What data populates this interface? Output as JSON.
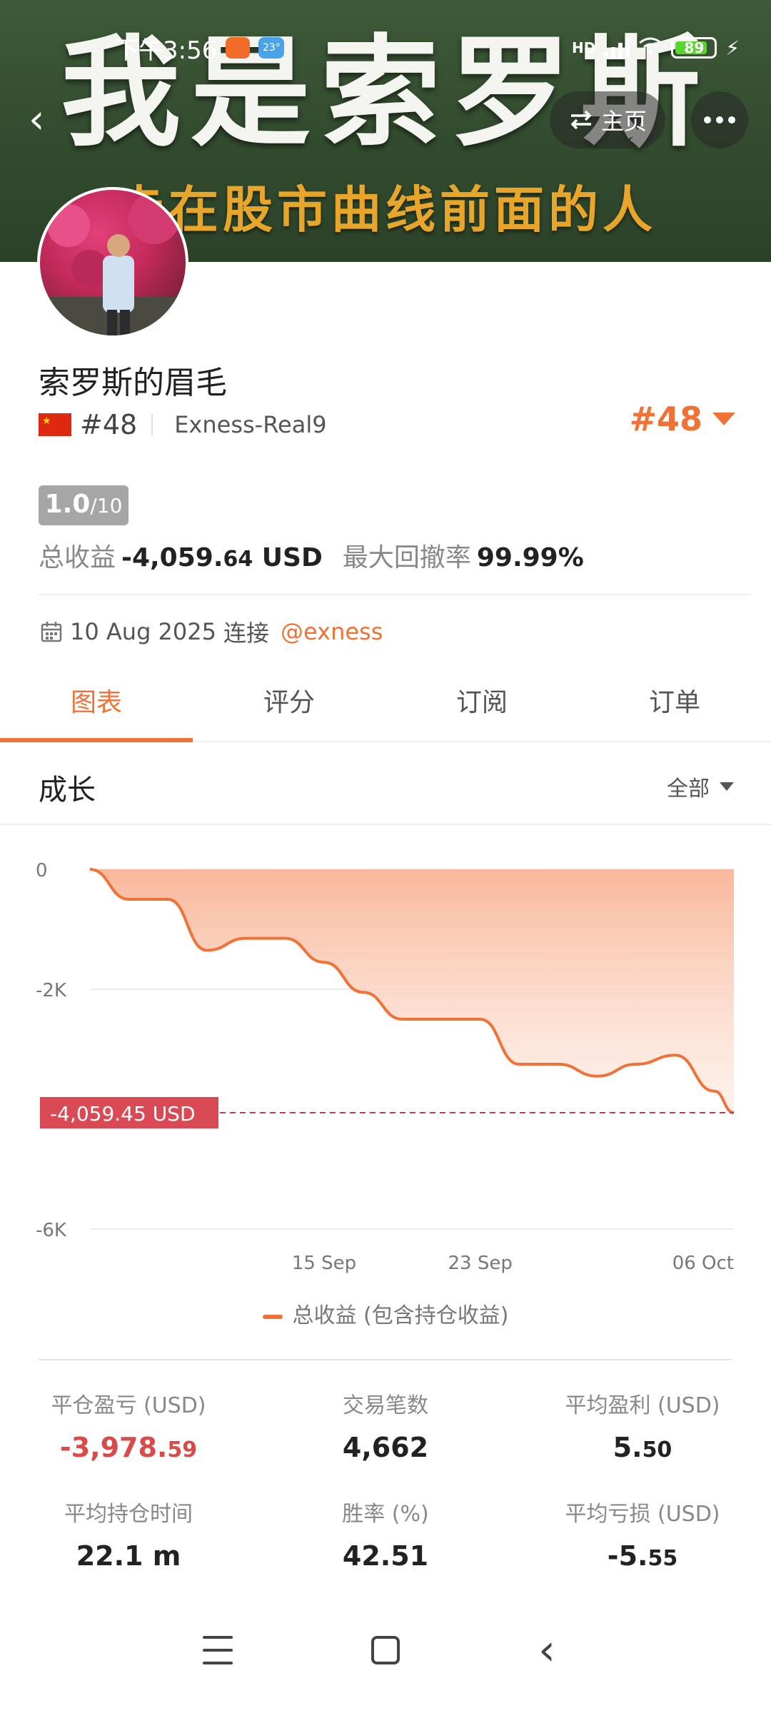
{
  "banner": {
    "title": "我是索罗斯",
    "subtitle": "走在股市曲线前面的人"
  },
  "status_bar": {
    "time": "下午3:56",
    "weather": "23°",
    "network": "HD",
    "battery": "89"
  },
  "header": {
    "home_label": "主页"
  },
  "profile": {
    "name": "索罗斯的眉毛",
    "rank": "#48",
    "broker": "Exness-Real9",
    "rank_badge": "#48",
    "score": "1.0",
    "score_max": "/10",
    "total_profit_label": "总收益",
    "total_profit_int": "-4,059.",
    "total_profit_dec": "64",
    "total_profit_unit": " USD",
    "max_drawdown_label": "最大回撤率",
    "max_drawdown_value": "99.99%",
    "connect_date": "10 Aug 2025",
    "connect_text": "连接",
    "connect_link": "@exness"
  },
  "tabs": [
    {
      "label": "图表",
      "active": true
    },
    {
      "label": "评分",
      "active": false
    },
    {
      "label": "订阅",
      "active": false
    },
    {
      "label": "订单",
      "active": false
    }
  ],
  "section": {
    "title": "成长",
    "filter": "全部"
  },
  "chart_data": {
    "type": "area",
    "y_ticks": [
      "0",
      "-2K",
      "-6K"
    ],
    "x_ticks": [
      "15 Sep",
      "23 Sep",
      "06 Oct"
    ],
    "ylim": [
      -6000,
      0
    ],
    "x": [
      "2025-09-03",
      "2025-09-05",
      "2025-09-07",
      "2025-09-09",
      "2025-09-11",
      "2025-09-13",
      "2025-09-15",
      "2025-09-17",
      "2025-09-19",
      "2025-09-21",
      "2025-09-23",
      "2025-09-25",
      "2025-09-27",
      "2025-09-29",
      "2025-10-01",
      "2025-10-03",
      "2025-10-05",
      "2025-10-06"
    ],
    "values": [
      0,
      -500,
      -500,
      -1350,
      -1150,
      -1150,
      -1550,
      -2050,
      -2500,
      -2500,
      -2500,
      -3250,
      -3250,
      -3450,
      -3250,
      -3100,
      -3700,
      -4059.45
    ],
    "current_label": "-4,059.45 USD",
    "legend": "总收益 (包含持仓收益)",
    "accent": "#f07236"
  },
  "stats": [
    {
      "label": "平仓盈亏 (USD)",
      "int": "-3,978.",
      "dec": "59",
      "negative": true
    },
    {
      "label": "交易笔数",
      "int": "4,662",
      "dec": "",
      "negative": false
    },
    {
      "label": "平均盈利 (USD)",
      "int": "5.",
      "dec": "50",
      "negative": false
    },
    {
      "label": "平均持仓时间",
      "int": "22.1 m",
      "dec": "",
      "negative": false
    },
    {
      "label": "胜率 (%)",
      "int": "42.51",
      "dec": "",
      "negative": false
    },
    {
      "label": "平均亏损 (USD)",
      "int": "-5.",
      "dec": "55",
      "negative": false
    }
  ],
  "colors": {
    "accent": "#f07236",
    "negative": "#d94a4a"
  }
}
